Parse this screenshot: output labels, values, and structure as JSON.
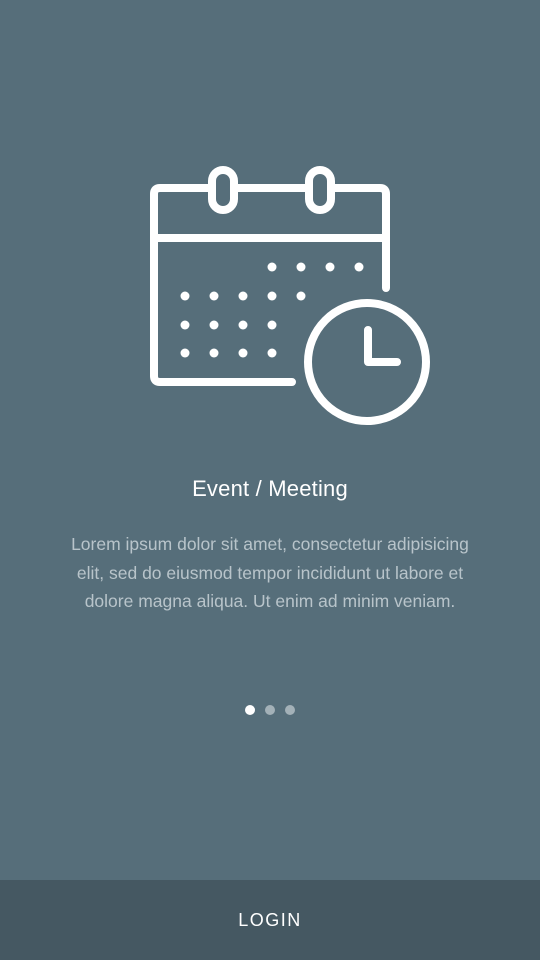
{
  "onboarding": {
    "icon": "calendar-clock-icon",
    "title": "Event / Meeting",
    "description": "Lorem ipsum dolor sit amet, consectetur adipisicing elit, sed do eiusmod tempor incididunt ut labore et dolore magna aliqua. Ut enim ad minim veniam.",
    "page_indicator": {
      "count": 3,
      "active": 1
    }
  },
  "footer": {
    "login_label": "LOGIN"
  },
  "colors": {
    "background": "#566e7a",
    "footer_background": "#455862",
    "title": "#ffffff",
    "description": "#b8c4ca",
    "dot_active": "#ffffff",
    "dot_inactive": "#a3b1b8"
  }
}
